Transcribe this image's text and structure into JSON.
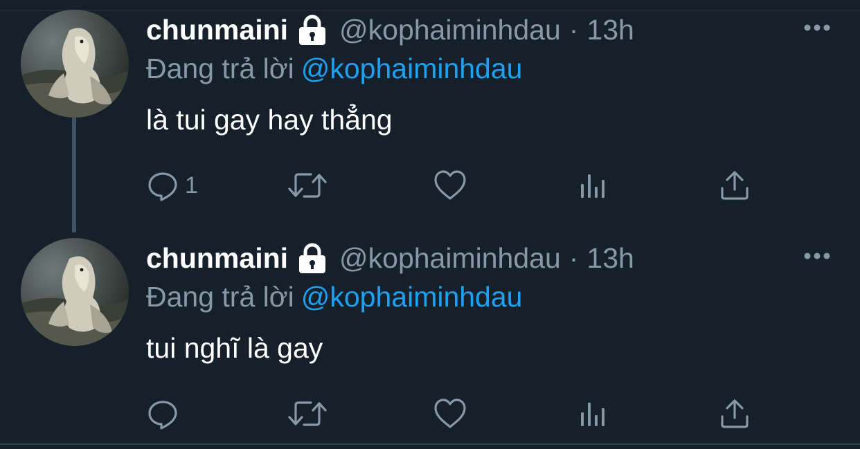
{
  "tweets": [
    {
      "author": {
        "name": "chunmaini",
        "handle": "@kophaiminhdau",
        "protected_icon": "lock-icon"
      },
      "separator": "·",
      "time": "13h",
      "reply_to": {
        "label": "Đang trả lời",
        "mention": "@kophaiminhdau"
      },
      "text": "là tui gay hay thẳng",
      "actions": {
        "reply_count": "1",
        "icons": [
          "reply-icon",
          "retweet-icon",
          "like-icon",
          "analytics-icon",
          "share-icon"
        ]
      }
    },
    {
      "author": {
        "name": "chunmaini",
        "handle": "@kophaiminhdau",
        "protected_icon": "lock-icon"
      },
      "separator": "·",
      "time": "13h",
      "reply_to": {
        "label": "Đang trả lời",
        "mention": "@kophaiminhdau"
      },
      "text": "tui nghĩ là gay",
      "actions": {
        "reply_count": "",
        "icons": [
          "reply-icon",
          "retweet-icon",
          "like-icon",
          "analytics-icon",
          "share-icon"
        ]
      }
    }
  ],
  "colors": {
    "background": "#15202b",
    "primary_text": "#ffffff",
    "secondary_text": "#8899a6",
    "accent": "#1da1f2",
    "thread_line": "#3d5466"
  }
}
